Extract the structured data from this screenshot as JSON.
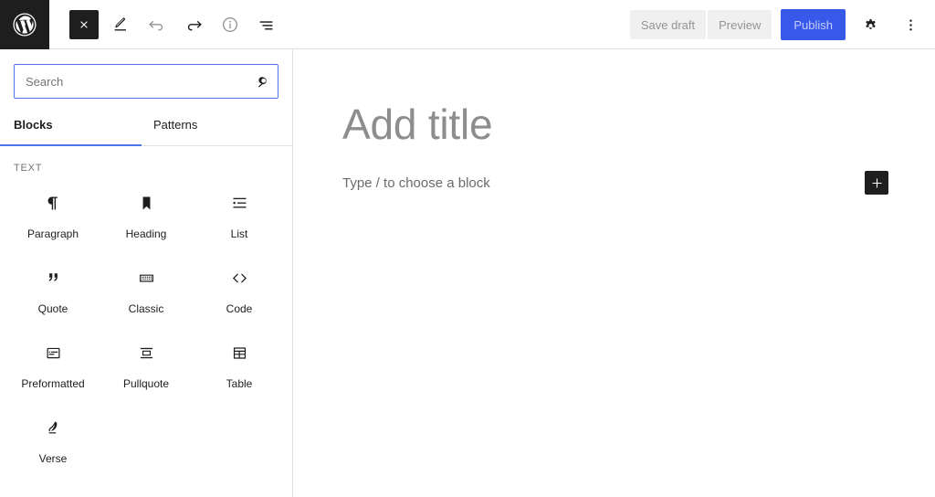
{
  "header": {
    "logo_icon": "wordpress-logo-icon",
    "left_tools": [
      {
        "name": "close-button",
        "icon": "close-icon",
        "state": "dark",
        "title": "Close"
      },
      {
        "name": "edit-mode-button",
        "icon": "pencil-icon",
        "state": "dark",
        "title": "Edit"
      },
      {
        "name": "undo-button",
        "icon": "undo-icon",
        "state": "muted",
        "title": "Undo"
      },
      {
        "name": "redo-button",
        "icon": "redo-icon",
        "state": "dark",
        "title": "Redo"
      },
      {
        "name": "details-button",
        "icon": "info-icon",
        "state": "muted",
        "title": "Details"
      },
      {
        "name": "list-view-button",
        "icon": "list-view-icon",
        "state": "dark",
        "title": "List view"
      }
    ],
    "save_draft_label": "Save draft",
    "preview_label": "Preview",
    "publish_label": "Publish",
    "settings_icon": "gear-icon",
    "more_options_icon": "kebab-menu-icon",
    "publish_bg_color": "#3858e9",
    "publish_text_color": "#c3cdf7"
  },
  "sidebar": {
    "search": {
      "placeholder": "Search",
      "value": "",
      "icon": "search-icon",
      "focus_color": "#4f73e8"
    },
    "tabs": [
      {
        "label": "Blocks",
        "active": true
      },
      {
        "label": "Patterns",
        "active": false
      }
    ],
    "active_tab_underline_color": "#4f73e8",
    "category_label": "TEXT",
    "blocks": [
      {
        "label": "Paragraph",
        "icon": "paragraph-icon"
      },
      {
        "label": "Heading",
        "icon": "heading-icon"
      },
      {
        "label": "List",
        "icon": "list-icon"
      },
      {
        "label": "Quote",
        "icon": "quote-icon"
      },
      {
        "label": "Classic",
        "icon": "classic-keyboard-icon"
      },
      {
        "label": "Code",
        "icon": "code-icon"
      },
      {
        "label": "Preformatted",
        "icon": "preformatted-icon"
      },
      {
        "label": "Pullquote",
        "icon": "pullquote-icon"
      },
      {
        "label": "Table",
        "icon": "table-icon"
      },
      {
        "label": "Verse",
        "icon": "verse-quill-icon"
      }
    ]
  },
  "editor": {
    "title_placeholder": "Add title",
    "block_placeholder": "Type / to choose a block",
    "add_block_icon": "plus-icon",
    "add_block_bg_color": "#1e1e1e"
  }
}
